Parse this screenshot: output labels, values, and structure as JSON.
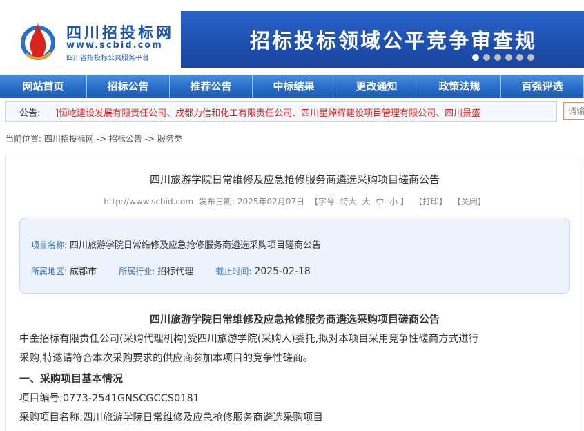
{
  "header": {
    "logo_title": "四川招投标网",
    "logo_url": "www.scbid.com",
    "logo_sub": "四川省招投标公共服务平台",
    "banner_text": "招标投标领域公平竞争审查规",
    "banner_dots": 6
  },
  "nav": {
    "items": [
      "网站首页",
      "招标公告",
      "推荐公告",
      "中标结果",
      "更改通知",
      "政策法规",
      "百强评选"
    ]
  },
  "notice": {
    "label": "公告:",
    "text": "]恒屹建设发展有限责任公司、成都力信和化工有限责任公司、四川星焯辉建设项目管理有限公司、四川景盛",
    "search_placeholder": "请输"
  },
  "breadcrumb": "当前位置: 四川招投标网 -> 招标公告 -> 服务类",
  "article": {
    "title": "四川旅游学院日常维修及应急抢修服务商遴选采购项目磋商公告",
    "meta": {
      "site": "http://www.scbid.com",
      "date_label": "发布日期:",
      "date": "2025年02月07日",
      "font_label": "【字号",
      "font_xl": "特大",
      "font_l": "大",
      "font_m": "中",
      "font_s": "小 】",
      "print": "【打印】",
      "close": "【关闭】"
    },
    "info": {
      "name_label": "项目名称:",
      "name": "四川旅游学院日常维修及应急抢修服务商遴选采购项目磋商公告",
      "region_label": "所属地区:",
      "region": "成都市",
      "industry_label": "所属行业:",
      "industry": "招标代理",
      "deadline_label": "截止时间:",
      "deadline": "2025-02-18"
    },
    "body_title": "四川旅游学院日常维修及应急抢修服务商遴选采购项目磋商公告",
    "para1_line1": "中金招标有限责任公司(采购代理机构)受四川旅游学院(采购人)委托,拟对本项目采用竞争性磋商方式进行",
    "para1_line2": "采购,特邀请符合本次采购要求的供应商参加本项目的竞争性磋商。",
    "section1": "一、采购项目基本情况",
    "project_no": "项目编号:0773-2541GNSCGCCS0181",
    "project_name": "采购项目名称:四川旅游学院日常维修及应急抢修服务商遴选采购项目"
  }
}
